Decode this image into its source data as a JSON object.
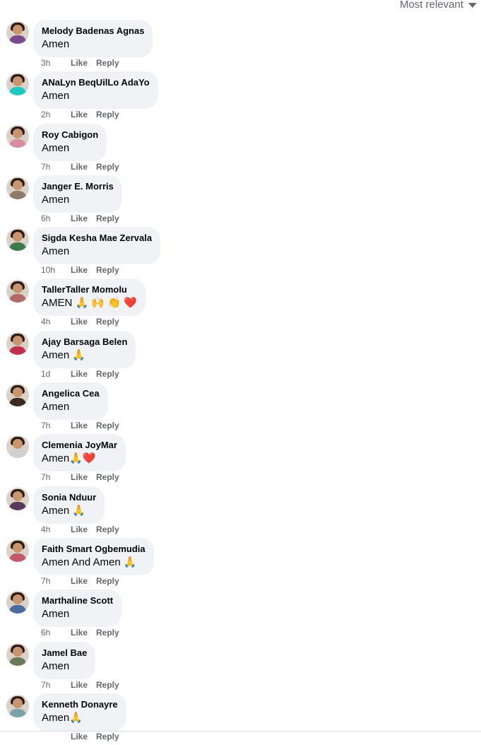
{
  "sort": {
    "label": "Most relevant"
  },
  "actions": {
    "like": "Like",
    "reply": "Reply"
  },
  "colors": {
    "bubble": "#f0f2f5",
    "meta": "#65676b",
    "text": "#050505"
  },
  "comments": [
    {
      "name": "Melody Badenas Agnas",
      "text": "Amen",
      "time": "3h",
      "avatar_color": "#7a4a8a"
    },
    {
      "name": "ANaLyn BeqUilLo AdaYo",
      "text": "Amen",
      "time": "2h",
      "avatar_color": "#1ec9c2"
    },
    {
      "name": "Roy Cabigon",
      "text": "Amen",
      "time": "7h",
      "avatar_color": "#d98ba0"
    },
    {
      "name": "Janger E. Morris",
      "text": "Amen",
      "time": "6h",
      "avatar_color": "#8f7a6a"
    },
    {
      "name": "Sigda Kesha Mae Zervala",
      "text": "Amen",
      "time": "10h",
      "avatar_color": "#3c7a4c"
    },
    {
      "name": "TallerTaller Momolu",
      "text": "AMEN 🙏 🙌 👏 ❤️",
      "time": "4h",
      "avatar_color": "#b06a6a"
    },
    {
      "name": "Ajay Barsaga Belen",
      "text": "Amen 🙏",
      "time": "1d",
      "avatar_color": "#c0304a"
    },
    {
      "name": "Angelica Cea",
      "text": "Amen",
      "time": "7h",
      "avatar_color": "#3a2a22"
    },
    {
      "name": "Clemenia JoyMar",
      "text": "Amen🙏❤️",
      "time": "7h",
      "avatar_color": "#d0d0d0"
    },
    {
      "name": "Sonia Nduur",
      "text": "Amen 🙏",
      "time": "4h",
      "avatar_color": "#5a3a5a"
    },
    {
      "name": "Faith Smart Ogbemudia",
      "text": "Amen And Amen 🙏",
      "time": "7h",
      "avatar_color": "#c05a6a"
    },
    {
      "name": "Marthaline Scott",
      "text": "Amen",
      "time": "6h",
      "avatar_color": "#4a6aa0"
    },
    {
      "name": "Jamel Bae",
      "text": "Amen",
      "time": "7h",
      "avatar_color": "#6a7a5a"
    },
    {
      "name": "Kenneth Donayre",
      "text": "Amen🙏",
      "time": "",
      "avatar_color": "#7aa0a8"
    }
  ]
}
